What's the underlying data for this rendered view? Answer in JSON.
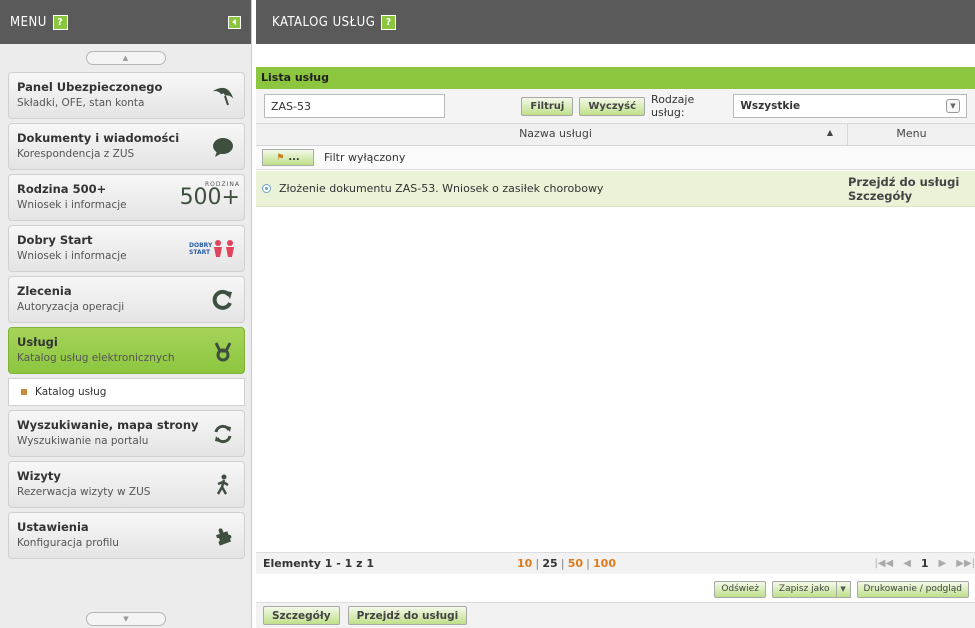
{
  "sidebar": {
    "title": "MENU",
    "help": "?",
    "items": [
      {
        "title": "Panel Ubezpieczonego",
        "sub": "Składki, OFE, stan konta",
        "icon": "umbrella-icon"
      },
      {
        "title": "Dokumenty i wiadomości",
        "sub": "Korespondencja z ZUS",
        "icon": "speech-bubble-icon"
      },
      {
        "title": "Rodzina 500+",
        "sub": "Wniosek i informacje",
        "icon": "rodzina-500-logo"
      },
      {
        "title": "Dobry Start",
        "sub": "Wniosek i informacje",
        "icon": "dobry-start-logo"
      },
      {
        "title": "Zlecenia",
        "sub": "Autoryzacja operacji",
        "icon": "refresh-arrow-icon"
      },
      {
        "title": "Usługi",
        "sub": "Katalog usług elektronicznych",
        "icon": "services-icon"
      },
      {
        "title": "Wyszukiwanie, mapa strony",
        "sub": "Wyszukiwanie na portalu",
        "icon": "sync-icon"
      },
      {
        "title": "Wizyty",
        "sub": "Rezerwacja wizyty w ZUS",
        "icon": "walking-person-icon"
      },
      {
        "title": "Ustawienia",
        "sub": "Konfiguracja profilu",
        "icon": "puzzle-icon"
      }
    ],
    "subitem": "Katalog usług",
    "logo_500_text": "500+",
    "logo_500_small": "RODZINA",
    "logo_dobry": "DOBRY START"
  },
  "main": {
    "title": "KATALOG USŁUG",
    "help": "?",
    "list_title": "Lista usług",
    "search_value": "ZAS-53",
    "filter_btn": "Filtruj",
    "clear_btn": "Wyczyść",
    "types_label": "Rodzaje usług:",
    "types_selected": "Wszystkie",
    "col_name": "Nazwa usługi",
    "col_menu": "Menu",
    "filter_toggle": "...",
    "filter_status": "Filtr wyłączony",
    "rows": [
      {
        "name": "Złożenie dokumentu ZAS-53. Wniosek o zasiłek chorobowy",
        "link1": "Przejdź do usługi",
        "link2": "Szczegóły"
      }
    ],
    "pager": {
      "info": "Elementy 1 - 1 z 1",
      "sizes": [
        "10",
        "25",
        "50",
        "100"
      ],
      "current_page": "1"
    },
    "actions": {
      "refresh": "Odśwież",
      "save_as": "Zapisz jako",
      "print": "Drukowanie / podgląd"
    },
    "bottom": {
      "details": "Szczegóły",
      "go": "Przejdź do usługi"
    }
  },
  "colors": {
    "accent": "#8cc63f",
    "header_bg": "#5a5a5a",
    "highlight_row": "#eaf3d8",
    "page_size_selected": "#e07a1c"
  }
}
